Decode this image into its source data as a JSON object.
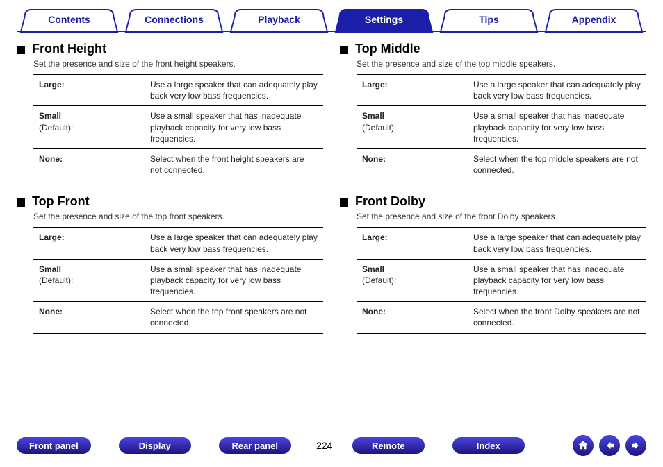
{
  "tabs": {
    "items": [
      {
        "id": "contents",
        "label": "Contents",
        "active": false
      },
      {
        "id": "connections",
        "label": "Connections",
        "active": false
      },
      {
        "id": "playback",
        "label": "Playback",
        "active": false
      },
      {
        "id": "settings",
        "label": "Settings",
        "active": true
      },
      {
        "id": "tips",
        "label": "Tips",
        "active": false
      },
      {
        "id": "appendix",
        "label": "Appendix",
        "active": false
      }
    ]
  },
  "sections": {
    "left": [
      {
        "id": "front_height",
        "title": "Front Height",
        "desc": "Set the presence and size of the front height speakers.",
        "rows": [
          {
            "k_bold": "Large:",
            "k_sub": "",
            "v": "Use a large speaker that can adequately play back very low bass frequencies."
          },
          {
            "k_bold": "Small",
            "k_sub": "(Default):",
            "v": "Use a small speaker that has inadequate playback capacity for very low bass frequencies."
          },
          {
            "k_bold": "None:",
            "k_sub": "",
            "v": "Select when the front height speakers are not connected."
          }
        ]
      },
      {
        "id": "top_front",
        "title": "Top Front",
        "desc": "Set the presence and size of the top front speakers.",
        "rows": [
          {
            "k_bold": "Large:",
            "k_sub": "",
            "v": "Use a large speaker that can adequately play back very low bass frequencies."
          },
          {
            "k_bold": "Small",
            "k_sub": "(Default):",
            "v": "Use a small speaker that has inadequate playback capacity for very low bass frequencies."
          },
          {
            "k_bold": "None:",
            "k_sub": "",
            "v": "Select when the top front speakers are not connected."
          }
        ]
      }
    ],
    "right": [
      {
        "id": "top_middle",
        "title": "Top Middle",
        "desc": "Set the presence and size of the top middle speakers.",
        "rows": [
          {
            "k_bold": "Large:",
            "k_sub": "",
            "v": "Use a large speaker that can adequately play back very low bass frequencies."
          },
          {
            "k_bold": "Small",
            "k_sub": "(Default):",
            "v": "Use a small speaker that has inadequate playback capacity for very low bass frequencies."
          },
          {
            "k_bold": "None:",
            "k_sub": "",
            "v": "Select when the top middle speakers are not connected."
          }
        ]
      },
      {
        "id": "front_dolby",
        "title": "Front Dolby",
        "desc": "Set the presence and size of the front Dolby speakers.",
        "rows": [
          {
            "k_bold": "Large:",
            "k_sub": "",
            "v": "Use a large speaker that can adequately play back very low bass frequencies."
          },
          {
            "k_bold": "Small",
            "k_sub": "(Default):",
            "v": "Use a small speaker that has inadequate playback capacity for very low bass frequencies."
          },
          {
            "k_bold": "None:",
            "k_sub": "",
            "v": "Select when the front Dolby speakers are not connected."
          }
        ]
      }
    ]
  },
  "footer": {
    "pills": {
      "front_panel": "Front panel",
      "display": "Display",
      "rear_panel": "Rear panel",
      "remote": "Remote",
      "index": "Index"
    },
    "page_number": "224",
    "icons": {
      "home": "home-icon",
      "prev": "arrow-left-icon",
      "next": "arrow-right-icon"
    }
  },
  "colors": {
    "brand": "#1a1ea8"
  }
}
